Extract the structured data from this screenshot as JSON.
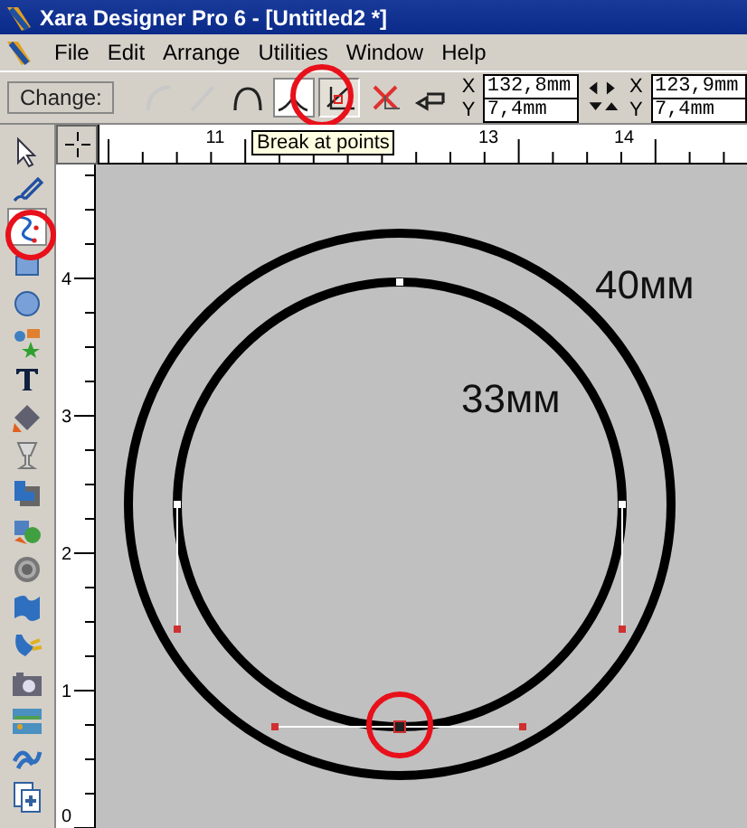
{
  "window": {
    "title": "Xara Designer Pro 6 - [Untitled2 *]"
  },
  "menu": [
    "File",
    "Edit",
    "Arrange",
    "Utilities",
    "Window",
    "Help"
  ],
  "infobar": {
    "label": "Change:",
    "buttons": [
      {
        "kind": "curve",
        "selected": false,
        "hovered": false
      },
      {
        "kind": "line",
        "selected": false,
        "hovered": false
      },
      {
        "kind": "smooth",
        "selected": false,
        "hovered": false
      },
      {
        "kind": "cusp",
        "selected": true,
        "hovered": false
      },
      {
        "kind": "break",
        "selected": false,
        "hovered": true
      },
      {
        "kind": "delete",
        "selected": false,
        "hovered": false
      },
      {
        "kind": "reverse",
        "selected": false,
        "hovered": false
      }
    ],
    "tooltip": "Break at points",
    "start": {
      "x_label": "X",
      "x": "132,8mm",
      "y_label": "Y",
      "y": "7,4mm"
    },
    "end": {
      "x_label": "X",
      "x": "123,9mm",
      "y_label": "Y",
      "y": "7,4mm"
    }
  },
  "tools": [
    {
      "kind": "selector",
      "selected": false
    },
    {
      "kind": "pen",
      "selected": false
    },
    {
      "kind": "shape-editor",
      "selected": true
    },
    {
      "kind": "rectangle",
      "selected": false
    },
    {
      "kind": "ellipse",
      "selected": false
    },
    {
      "kind": "quickshape",
      "selected": false
    },
    {
      "kind": "text",
      "selected": false
    },
    {
      "kind": "fill",
      "selected": false
    },
    {
      "kind": "transparency",
      "selected": false
    },
    {
      "kind": "shadow",
      "selected": false
    },
    {
      "kind": "blend",
      "selected": false
    },
    {
      "kind": "contour",
      "selected": false
    },
    {
      "kind": "mould",
      "selected": false
    },
    {
      "kind": "live-effect",
      "selected": false
    },
    {
      "kind": "photo",
      "selected": false
    },
    {
      "kind": "image",
      "selected": false
    },
    {
      "kind": "web",
      "selected": false
    },
    {
      "kind": "page",
      "selected": false
    }
  ],
  "ruler_h": [
    "11",
    "13",
    "14"
  ],
  "ruler_v": [
    "4",
    "3",
    "2",
    "1",
    "0"
  ],
  "canvas": {
    "outer_label": "40мм",
    "inner_label": "33мм"
  }
}
